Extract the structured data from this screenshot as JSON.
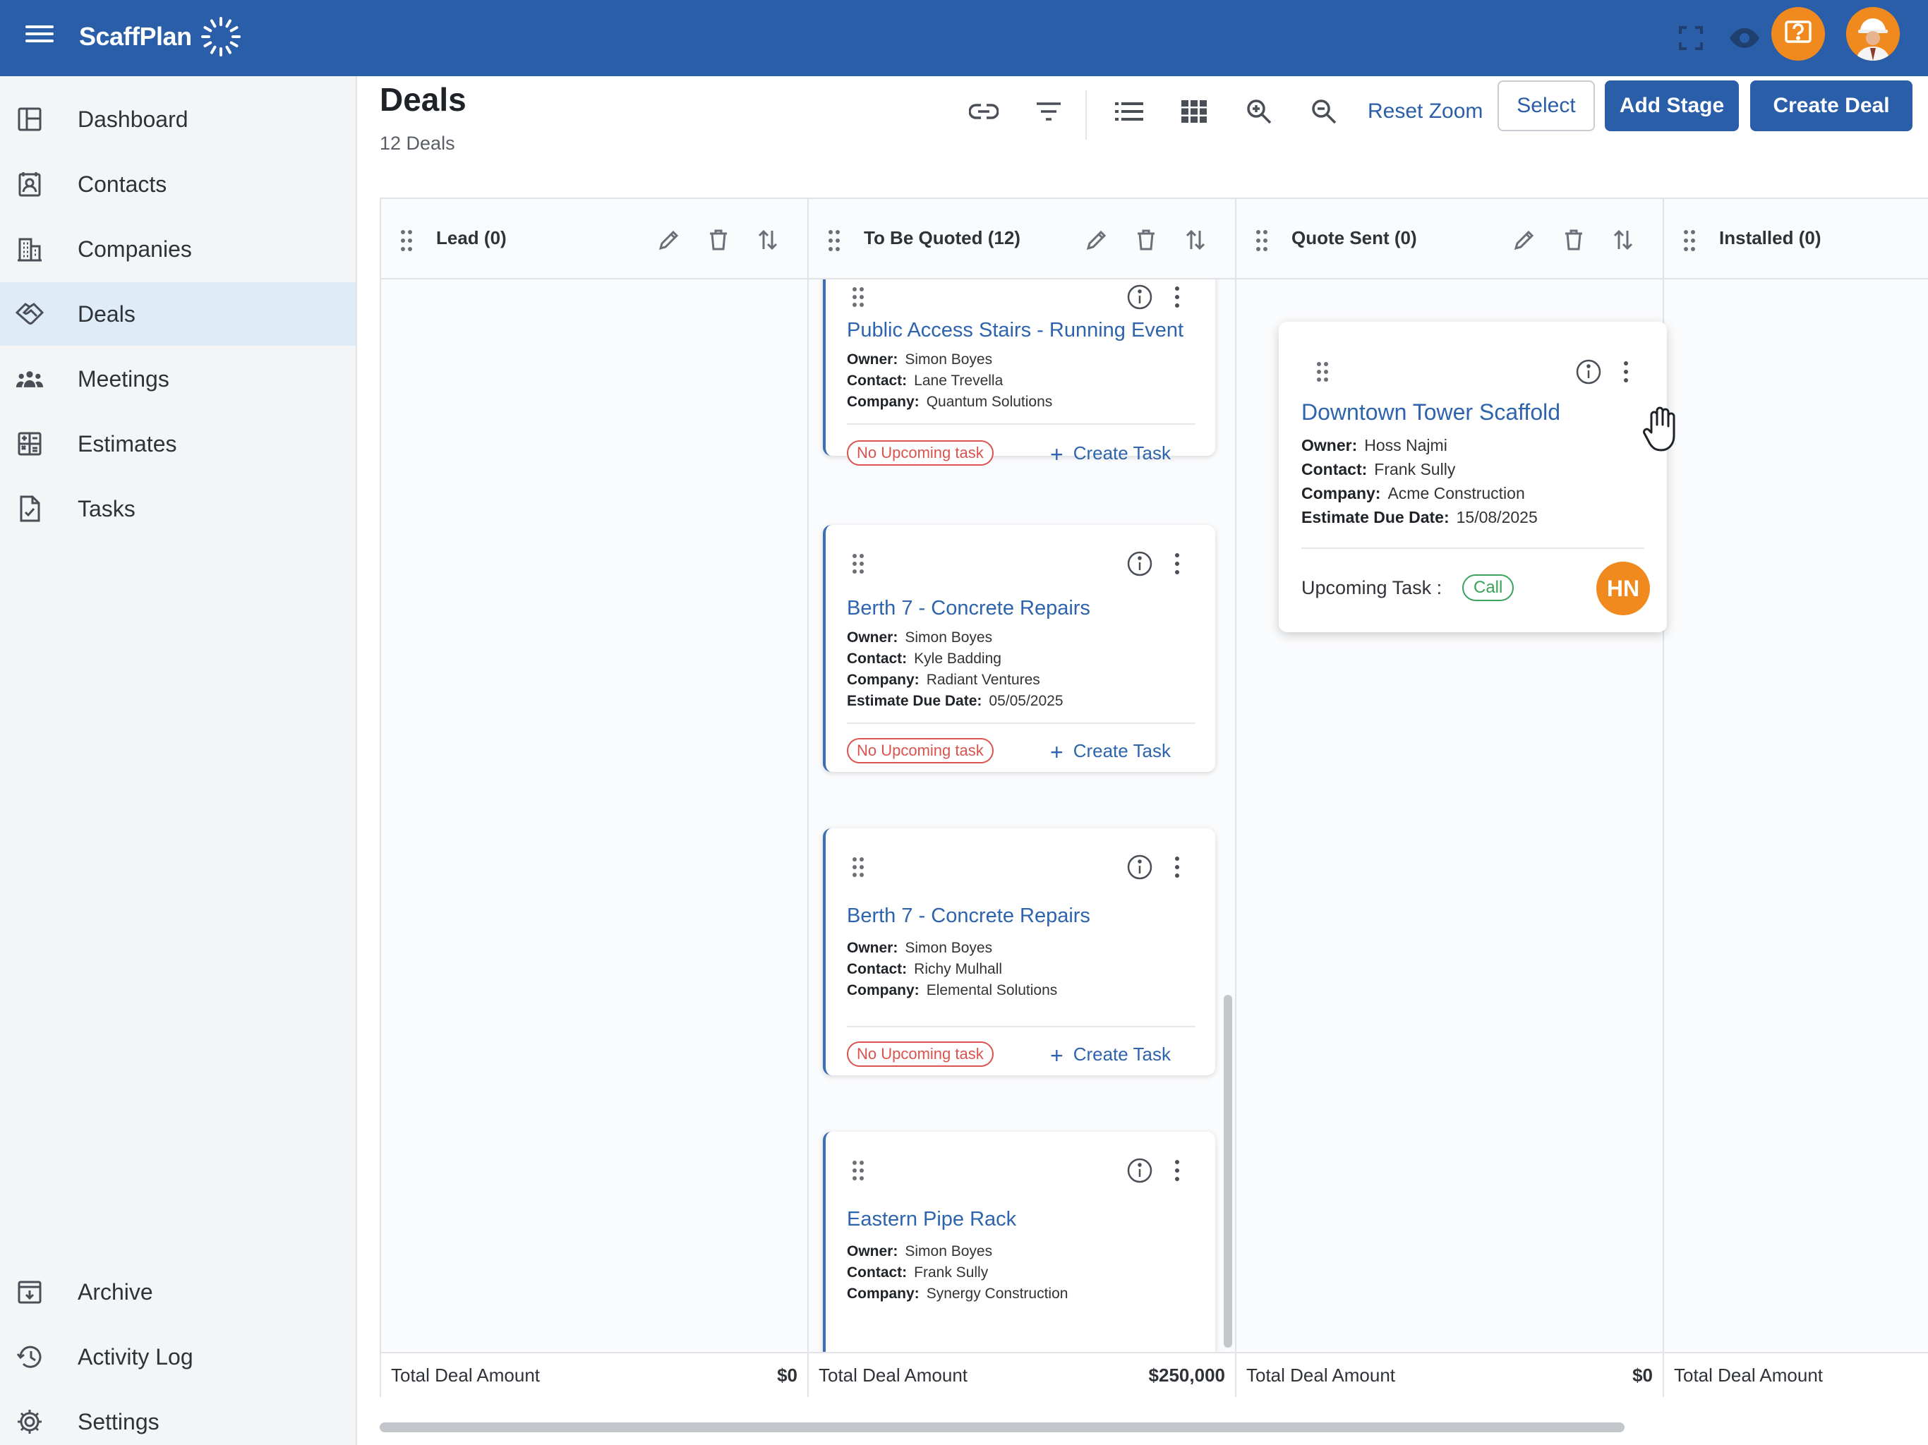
{
  "app": {
    "brand": "ScaffPlan",
    "colors": {
      "primary": "#2a5ea8",
      "accent": "#f08a1e",
      "danger": "#d9534f",
      "success": "#3aa35b"
    }
  },
  "topbar": {
    "icons": [
      "hamburger-menu-icon",
      "fullscreen-icon",
      "eye-icon",
      "help-icon",
      "user-avatar"
    ]
  },
  "sidebar": {
    "items": [
      {
        "label": "Dashboard",
        "icon": "dashboard-icon"
      },
      {
        "label": "Contacts",
        "icon": "contacts-icon"
      },
      {
        "label": "Companies",
        "icon": "companies-icon"
      },
      {
        "label": "Deals",
        "icon": "deals-icon",
        "active": true
      },
      {
        "label": "Meetings",
        "icon": "meetings-icon"
      },
      {
        "label": "Estimates",
        "icon": "estimates-icon"
      },
      {
        "label": "Tasks",
        "icon": "tasks-icon"
      }
    ],
    "bottom_items": [
      {
        "label": "Archive",
        "icon": "archive-icon"
      },
      {
        "label": "Activity Log",
        "icon": "history-icon"
      },
      {
        "label": "Settings",
        "icon": "gear-icon"
      }
    ]
  },
  "page": {
    "title": "Deals",
    "subtitle": "12 Deals"
  },
  "toolbar": {
    "reset_zoom": "Reset Zoom",
    "select": "Select",
    "add_stage": "Add Stage",
    "create_deal": "Create Deal"
  },
  "columns": [
    {
      "title": "Lead (0)",
      "footer_label": "Total Deal Amount",
      "footer_amount": "$0"
    },
    {
      "title": "To Be Quoted (12)",
      "footer_label": "Total Deal Amount",
      "footer_amount": "$250,000"
    },
    {
      "title": "Quote Sent (0)",
      "footer_label": "Total Deal Amount",
      "footer_amount": "$0"
    },
    {
      "title": "Installed (0)",
      "footer_label": "Total Deal Amount",
      "footer_amount": ""
    }
  ],
  "labels": {
    "owner": "Owner:",
    "contact": "Contact:",
    "company": "Company:",
    "estimate_due": "Estimate Due Date:",
    "no_task": "No Upcoming task",
    "create_task": "Create Task",
    "upcoming_task": "Upcoming Task :"
  },
  "cards": [
    {
      "title": "Public Access Stairs - Running Event",
      "owner": "Simon Boyes",
      "contact": "Lane Trevella",
      "company": "Quantum Solutions"
    },
    {
      "title": "Berth 7 - Concrete Repairs",
      "owner": "Simon Boyes",
      "contact": "Kyle Badding",
      "company": "Radiant Ventures",
      "estimate_due": "05/05/2025"
    },
    {
      "title": "Berth 7 - Concrete Repairs",
      "owner": "Simon Boyes",
      "contact": "Richy Mulhall",
      "company": "Elemental Solutions"
    },
    {
      "title": "Eastern Pipe Rack",
      "owner": "Simon Boyes",
      "contact": "Frank Sully",
      "company": "Synergy Construction"
    }
  ],
  "dragged_card": {
    "title": "Downtown Tower Scaffold",
    "owner": "Hoss Najmi",
    "contact": "Frank Sully",
    "company": "Acme Construction",
    "estimate_due": "15/08/2025",
    "task_type": "Call",
    "assignee_initials": "HN"
  }
}
